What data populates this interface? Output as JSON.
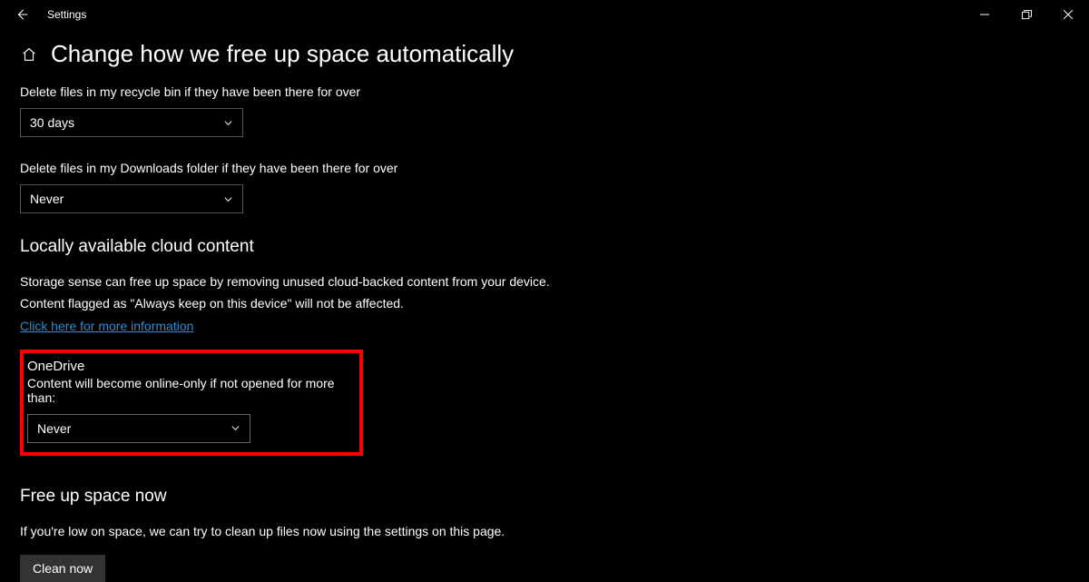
{
  "titlebar": {
    "app_name": "Settings"
  },
  "header": {
    "page_title": "Change how we free up space automatically"
  },
  "recycle": {
    "label": "Delete files in my recycle bin if they have been there for over",
    "value": "30 days"
  },
  "downloads": {
    "label": "Delete files in my Downloads folder if they have been there for over",
    "value": "Never"
  },
  "cloud": {
    "heading": "Locally available cloud content",
    "line1": "Storage sense can free up space by removing unused cloud-backed content from your device.",
    "line2": "Content flagged as \"Always keep on this device\" will not be affected.",
    "link": "Click here for more information"
  },
  "onedrive": {
    "title": "OneDrive",
    "subtitle": "Content will become online-only if not opened for more than:",
    "value": "Never",
    "highlight_color": "#ff0000"
  },
  "freeup": {
    "heading": "Free up space now",
    "desc": "If you're low on space, we can try to clean up files now using the settings on this page.",
    "button": "Clean now"
  }
}
